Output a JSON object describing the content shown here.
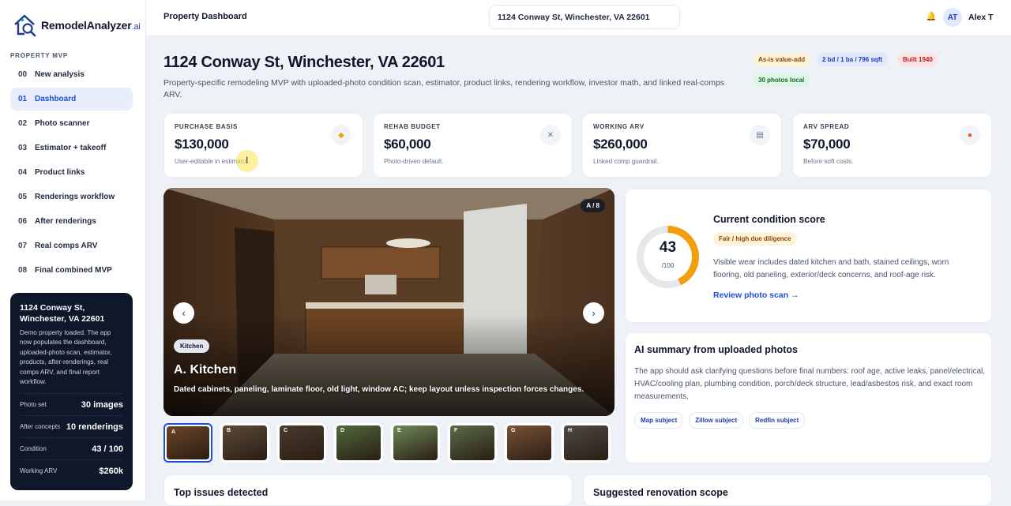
{
  "app": {
    "name": "RemodelAnalyzer",
    "suffix": ".ai"
  },
  "sidebar": {
    "section_label": "PROPERTY MVP",
    "items": [
      {
        "num": "00",
        "label": "New analysis"
      },
      {
        "num": "01",
        "label": "Dashboard",
        "active": true
      },
      {
        "num": "02",
        "label": "Photo scanner"
      },
      {
        "num": "03",
        "label": "Estimator + takeoff"
      },
      {
        "num": "04",
        "label": "Product links"
      },
      {
        "num": "05",
        "label": "Renderings workflow"
      },
      {
        "num": "06",
        "label": "After renderings"
      },
      {
        "num": "07",
        "label": "Real comps ARV"
      },
      {
        "num": "08",
        "label": "Final combined MVP"
      }
    ],
    "card": {
      "address": "1124 Conway St, Winchester, VA 22601",
      "description": "Demo property loaded. The app now populates the dashboard, uploaded-photo scan, estimator, products, after-renderings, real comps ARV, and final report workflow.",
      "stats": [
        {
          "label": "Photo set",
          "value": "30 images"
        },
        {
          "label": "After concepts",
          "value": "10 renderings"
        },
        {
          "label": "Condition",
          "value": "43 / 100"
        },
        {
          "label": "Working ARV",
          "value": "$260k"
        }
      ]
    }
  },
  "topbar": {
    "title": "Property Dashboard",
    "search_value": "1124 Conway St, Winchester, VA 22601",
    "user_initials": "AT",
    "user_name": "Alex T",
    "bell_icon": "bell-icon"
  },
  "header": {
    "title": "1124 Conway St, Winchester, VA 22601",
    "subtitle": "Property-specific remodeling MVP with uploaded-photo condition scan, estimator, product links, rendering workflow, investor math, and linked real-comps ARV.",
    "badges": [
      "As-is value-add",
      "2 bd / 1 ba / 796 sqft",
      "Built 1940",
      "30 photos local"
    ]
  },
  "kpis": [
    {
      "label": "PURCHASE BASIS",
      "value": "$130,000",
      "note": "User-editable in estimator.",
      "icon": "tag-icon"
    },
    {
      "label": "REHAB BUDGET",
      "value": "$60,000",
      "note": "Photo-driven default.",
      "icon": "tools-icon"
    },
    {
      "label": "WORKING ARV",
      "value": "$260,000",
      "note": "Linked comp guardrail.",
      "icon": "chart-icon"
    },
    {
      "label": "ARV SPREAD",
      "value": "$70,000",
      "note": "Before soft costs.",
      "icon": "fire-icon"
    }
  ],
  "gallery": {
    "counter": "A / 8",
    "tag": "Kitchen",
    "title": "A. Kitchen",
    "description": "Dated cabinets, paneling, laminate floor, old light, window AC; keep layout unless inspection forces changes.",
    "prev": "‹",
    "next": "›",
    "thumbs": [
      "A",
      "B",
      "C",
      "D",
      "E",
      "F",
      "G",
      "H"
    ]
  },
  "condition": {
    "score": 43,
    "denominator": "/100",
    "title": "Current condition score",
    "rating": "Fair / high due diligence",
    "text": "Visible wear includes dated kitchen and bath, stained ceilings, worn flooring, old paneling, exterior/deck concerns, and roof-age risk.",
    "link": "Review photo scan →"
  },
  "ai_summary": {
    "title": "AI summary from uploaded photos",
    "text": "The app should ask clarifying questions before final numbers: roof age, active leaks, panel/electrical, HVAC/cooling plan, plumbing condition, porch/deck structure, lead/asbestos risk, and exact room measurements.",
    "chips": [
      "Map subject",
      "Zillow subject",
      "Redfin subject"
    ]
  },
  "bottom": {
    "issues_title": "Top issues detected",
    "scope_title": "Suggested renovation scope"
  },
  "colors": {
    "accent": "#1d4ed8",
    "ring": "#f59e0b",
    "dark_card": "#0f172a"
  }
}
